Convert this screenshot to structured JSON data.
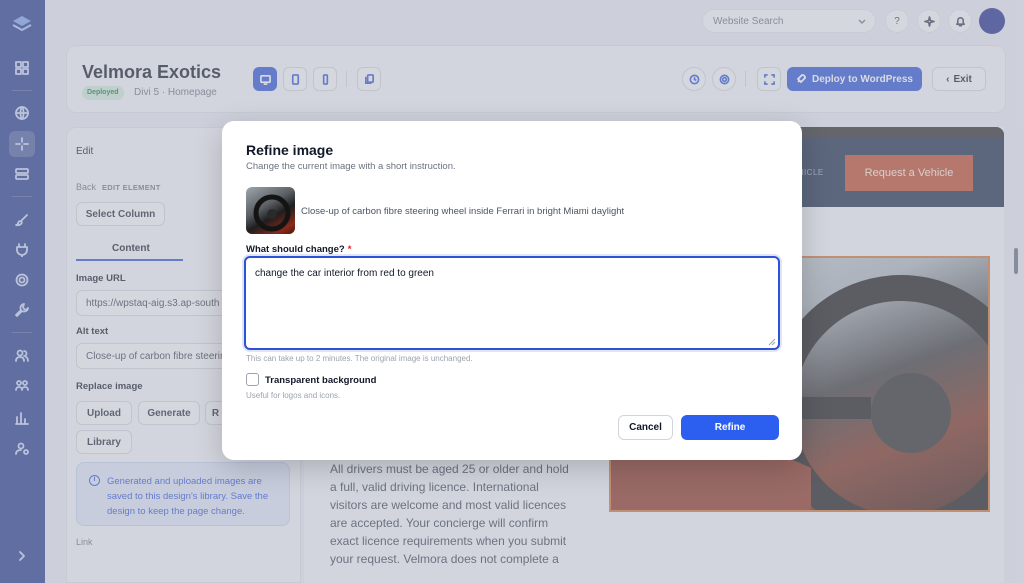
{
  "topbar": {
    "search_placeholder": "Website Search",
    "help_label": "?"
  },
  "header": {
    "title": "Velmora Exotics",
    "status_badge": "Deployed",
    "subinfo": "Divi 5 · Homepage",
    "deploy_label": "Deploy to WordPress",
    "exit_label": "Exit"
  },
  "edit_panel": {
    "heading": "Edit",
    "back_label": "Back",
    "section_label": "EDIT ELEMENT",
    "select_column_label": "Select Column",
    "tab_content": "Content",
    "image_url_label": "Image URL",
    "image_url_value": "https://wpstaq-aig.s3.ap-south",
    "alt_text_label": "Alt text",
    "alt_text_value": "Close-up of carbon fibre steering",
    "replace_image_label": "Replace image",
    "upload_label": "Upload",
    "generate_label": "Generate",
    "r_label": "R",
    "library_label": "Library",
    "info_text": "Generated and uploaded images are saved to this design's library. Save the design to keep the page change.",
    "link_label": "Link"
  },
  "preview": {
    "nav_vehicle": "VEHICLE",
    "request_button": "Request a Vehicle",
    "body_text": "All drivers must be aged 25 or older and hold a full, valid driving licence. International visitors are welcome and most valid licences are accepted. Your concierge will confirm exact licence requirements when you submit your request. Velmora does not complete a"
  },
  "modal": {
    "title": "Refine image",
    "subtitle": "Change the current image with a short instruction.",
    "image_caption": "Close-up of carbon fibre steering wheel inside Ferrari in bright Miami daylight",
    "question_label": "What should change?",
    "required_mark": "*",
    "instruction_value": "change the car interior from red to green",
    "help_text": "This can take up to 2 minutes. The original image is unchanged.",
    "transparent_label": "Transparent background",
    "transparent_help": "Useful for logos and icons.",
    "cancel_label": "Cancel",
    "refine_label": "Refine"
  },
  "colors": {
    "brand": "#2c52d6",
    "rail": "#263a8a",
    "accent_orange": "#c04b2a"
  }
}
